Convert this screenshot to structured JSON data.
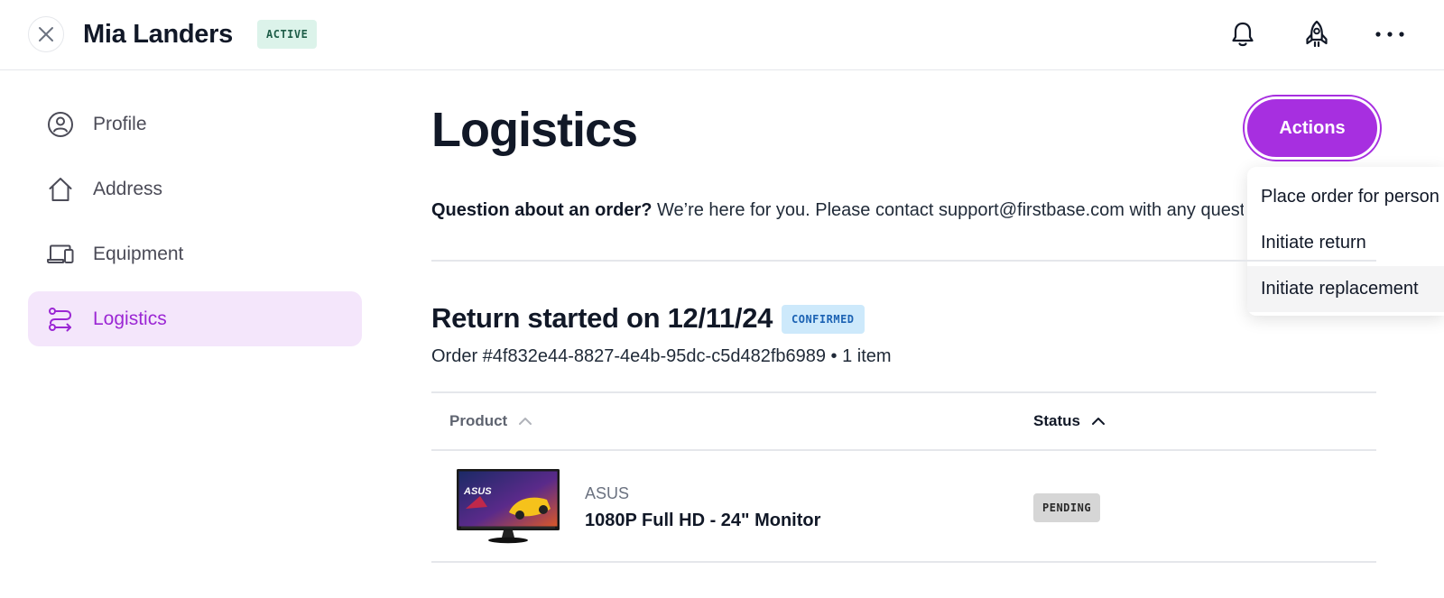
{
  "header": {
    "user_name": "Mia Landers",
    "status_badge": "ACTIVE",
    "icons": [
      "close-icon",
      "bell-icon",
      "rocket-icon",
      "more-horizontal-icon"
    ]
  },
  "sidebar": {
    "items": [
      {
        "label": "Profile",
        "icon": "user-circle-icon",
        "selected": false
      },
      {
        "label": "Address",
        "icon": "home-icon",
        "selected": false
      },
      {
        "label": "Equipment",
        "icon": "laptop-phone-icon",
        "selected": false
      },
      {
        "label": "Logistics",
        "icon": "route-icon",
        "selected": true
      }
    ]
  },
  "main": {
    "title": "Logistics",
    "actions_label": "Actions",
    "actions_menu": [
      "Place order for person",
      "Initiate return",
      "Initiate replacement"
    ],
    "info": {
      "bold": "Question about an order?",
      "text": " We’re here for you. Please contact support@firstbase.com with any questi"
    },
    "return": {
      "title": "Return started on 12/11/24",
      "badge": "CONFIRMED",
      "order_line": "Order #4f832e44-8827-4e4b-95dc-c5d482fb6989  •  1 item"
    },
    "table": {
      "columns": [
        {
          "label": "Product",
          "sorted": false
        },
        {
          "label": "Status",
          "sorted": true
        }
      ],
      "rows": [
        {
          "brand": "ASUS",
          "product": "1080P Full HD - 24\" Monitor",
          "status": "PENDING",
          "image_text": "ASUS"
        }
      ]
    }
  },
  "colors": {
    "accent": "#a72fe0",
    "selected_bg": "#f4e6fb",
    "active_badge_bg": "#dcf3ea",
    "confirmed_badge_bg": "#cde9fb",
    "pending_badge_bg": "#d6d6d6"
  }
}
